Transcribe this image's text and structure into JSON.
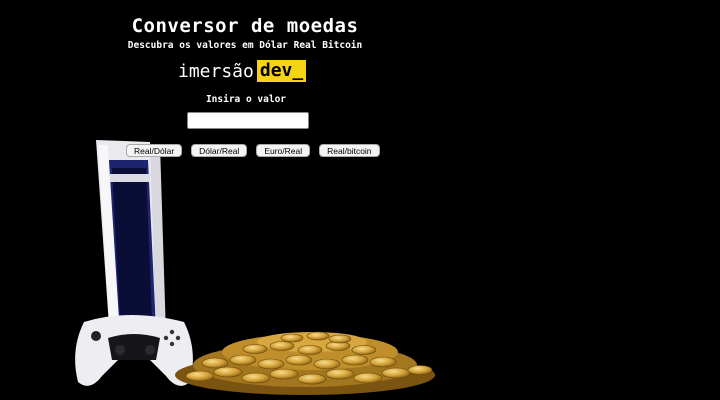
{
  "header": {
    "title": "Conversor de moedas",
    "subtitle": "Descubra os valores em Dólar Real Bitcoin"
  },
  "logo": {
    "part1": "imersão",
    "part2": "dev_",
    "accent_color": "#f5d414"
  },
  "form": {
    "label": "Insira o valor",
    "value": "",
    "placeholder": ""
  },
  "buttons": [
    {
      "label": "Real/Dólar"
    },
    {
      "label": "Dólar/Real"
    },
    {
      "label": "Euro/Real"
    },
    {
      "label": "Real/bitcoin"
    }
  ],
  "colors": {
    "background": "#000000",
    "text": "#ffffff",
    "coin": "#d4a33a"
  }
}
